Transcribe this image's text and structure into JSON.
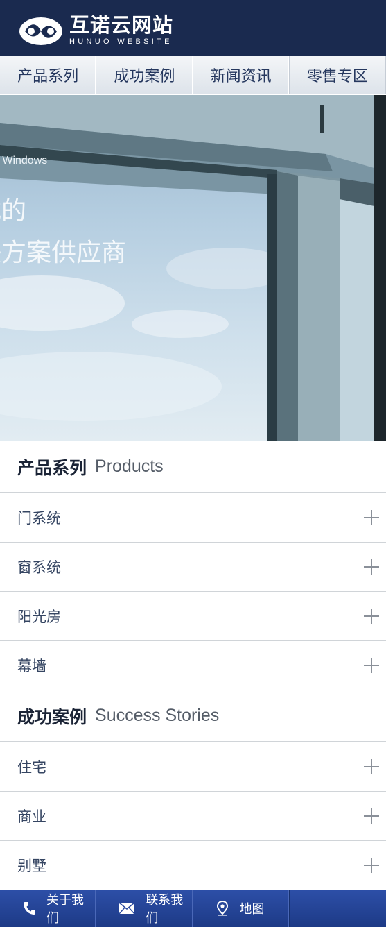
{
  "header": {
    "logo_title": "互诺云网站",
    "logo_subtitle": "HUNUO WEBSITE",
    "colors": {
      "background": "#1a2a4f"
    }
  },
  "nav": {
    "items": [
      {
        "label": "产品系列"
      },
      {
        "label": "成功案例"
      },
      {
        "label": "新闻资讯"
      },
      {
        "label": "零售专区"
      }
    ]
  },
  "banner": {
    "small_text": "d Windows",
    "line1": "式的",
    "line2": "决方案供应商"
  },
  "products": {
    "title_cn": "产品系列",
    "title_en": "Products",
    "items": [
      {
        "label": "门系统",
        "icon": "plus-icon"
      },
      {
        "label": "窗系统",
        "icon": "plus-icon"
      },
      {
        "label": "阳光房",
        "icon": "plus-icon"
      },
      {
        "label": "幕墙",
        "icon": "plus-icon"
      }
    ]
  },
  "cases": {
    "title_cn": "成功案例",
    "title_en": "Success Stories",
    "items": [
      {
        "label": "住宅",
        "icon": "plus-icon"
      },
      {
        "label": "商业",
        "icon": "plus-icon"
      },
      {
        "label": "别墅",
        "icon": "plus-icon"
      }
    ]
  },
  "footer": {
    "items": [
      {
        "label": "关于我们",
        "icon": "phone-icon"
      },
      {
        "label": "联系我们",
        "icon": "mail-icon"
      },
      {
        "label": "地图",
        "icon": "map-pin-icon"
      },
      {
        "label": "",
        "icon": ""
      }
    ],
    "colors": {
      "background": "#2d4fa8"
    }
  }
}
